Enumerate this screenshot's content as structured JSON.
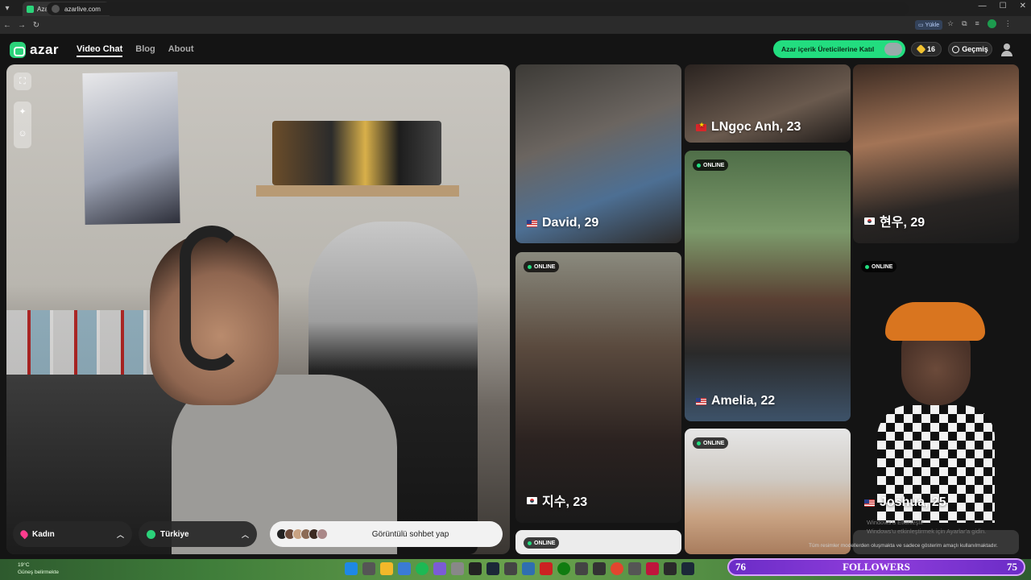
{
  "browser": {
    "tab_title": "Azar: Görüntülü Sohbet &",
    "url": "azarlive.com",
    "yukle_label": "Yükle"
  },
  "site": {
    "logo_text": "azar",
    "nav": [
      {
        "label": "Video Chat",
        "active": true
      },
      {
        "label": "Blog",
        "active": false
      },
      {
        "label": "About",
        "active": false
      }
    ],
    "join_label": "Azar içerik Üreticilerine Katıl",
    "coins": "16",
    "history_label": "Geçmiş"
  },
  "video": {
    "gender_filter": "Kadın",
    "country_filter": "Türkiye",
    "chat_button": "Görüntülü sohbet yap",
    "face_colors": [
      "#6b4a3a",
      "#c9a383",
      "#8c6b55",
      "#3c2b22",
      "#a88"
    ]
  },
  "profiles": {
    "online_label": "ONLINE",
    "cards": [
      {
        "name": "David, 29",
        "flag": "us",
        "online": false
      },
      {
        "name": "지수, 23",
        "flag": "kr",
        "online": true
      },
      {
        "name": "",
        "flag": "",
        "online": true
      },
      {
        "name": "LNgọc Anh, 23",
        "flag": "vn",
        "online": false
      },
      {
        "name": "Amelia, 22",
        "flag": "us",
        "online": true
      },
      {
        "name": "",
        "flag": "",
        "online": true
      },
      {
        "name": "현우, 29",
        "flag": "kr",
        "online": false
      },
      {
        "name": "Joshua, 25",
        "flag": "us",
        "online": true
      }
    ],
    "windows_note": "Windows'u Etkinleştir",
    "windows_note_sub": "Windows'u etkinleştirmek için Ayarlar'a gidin.",
    "model_note": "Tüm resimler modellerden oluşmakta ve sadece gösterim amaçlı kullanılmaktadır."
  },
  "taskbar": {
    "temp": "19°C",
    "weather": "Güneş belirmekte",
    "followers_label": "FOLLOWERS",
    "followers_left": "76",
    "followers_right": "75"
  },
  "colors": {
    "brand_green": "#22dd7f",
    "online_dot": "#22dd7f",
    "followers_purple": "#7b33d1"
  }
}
